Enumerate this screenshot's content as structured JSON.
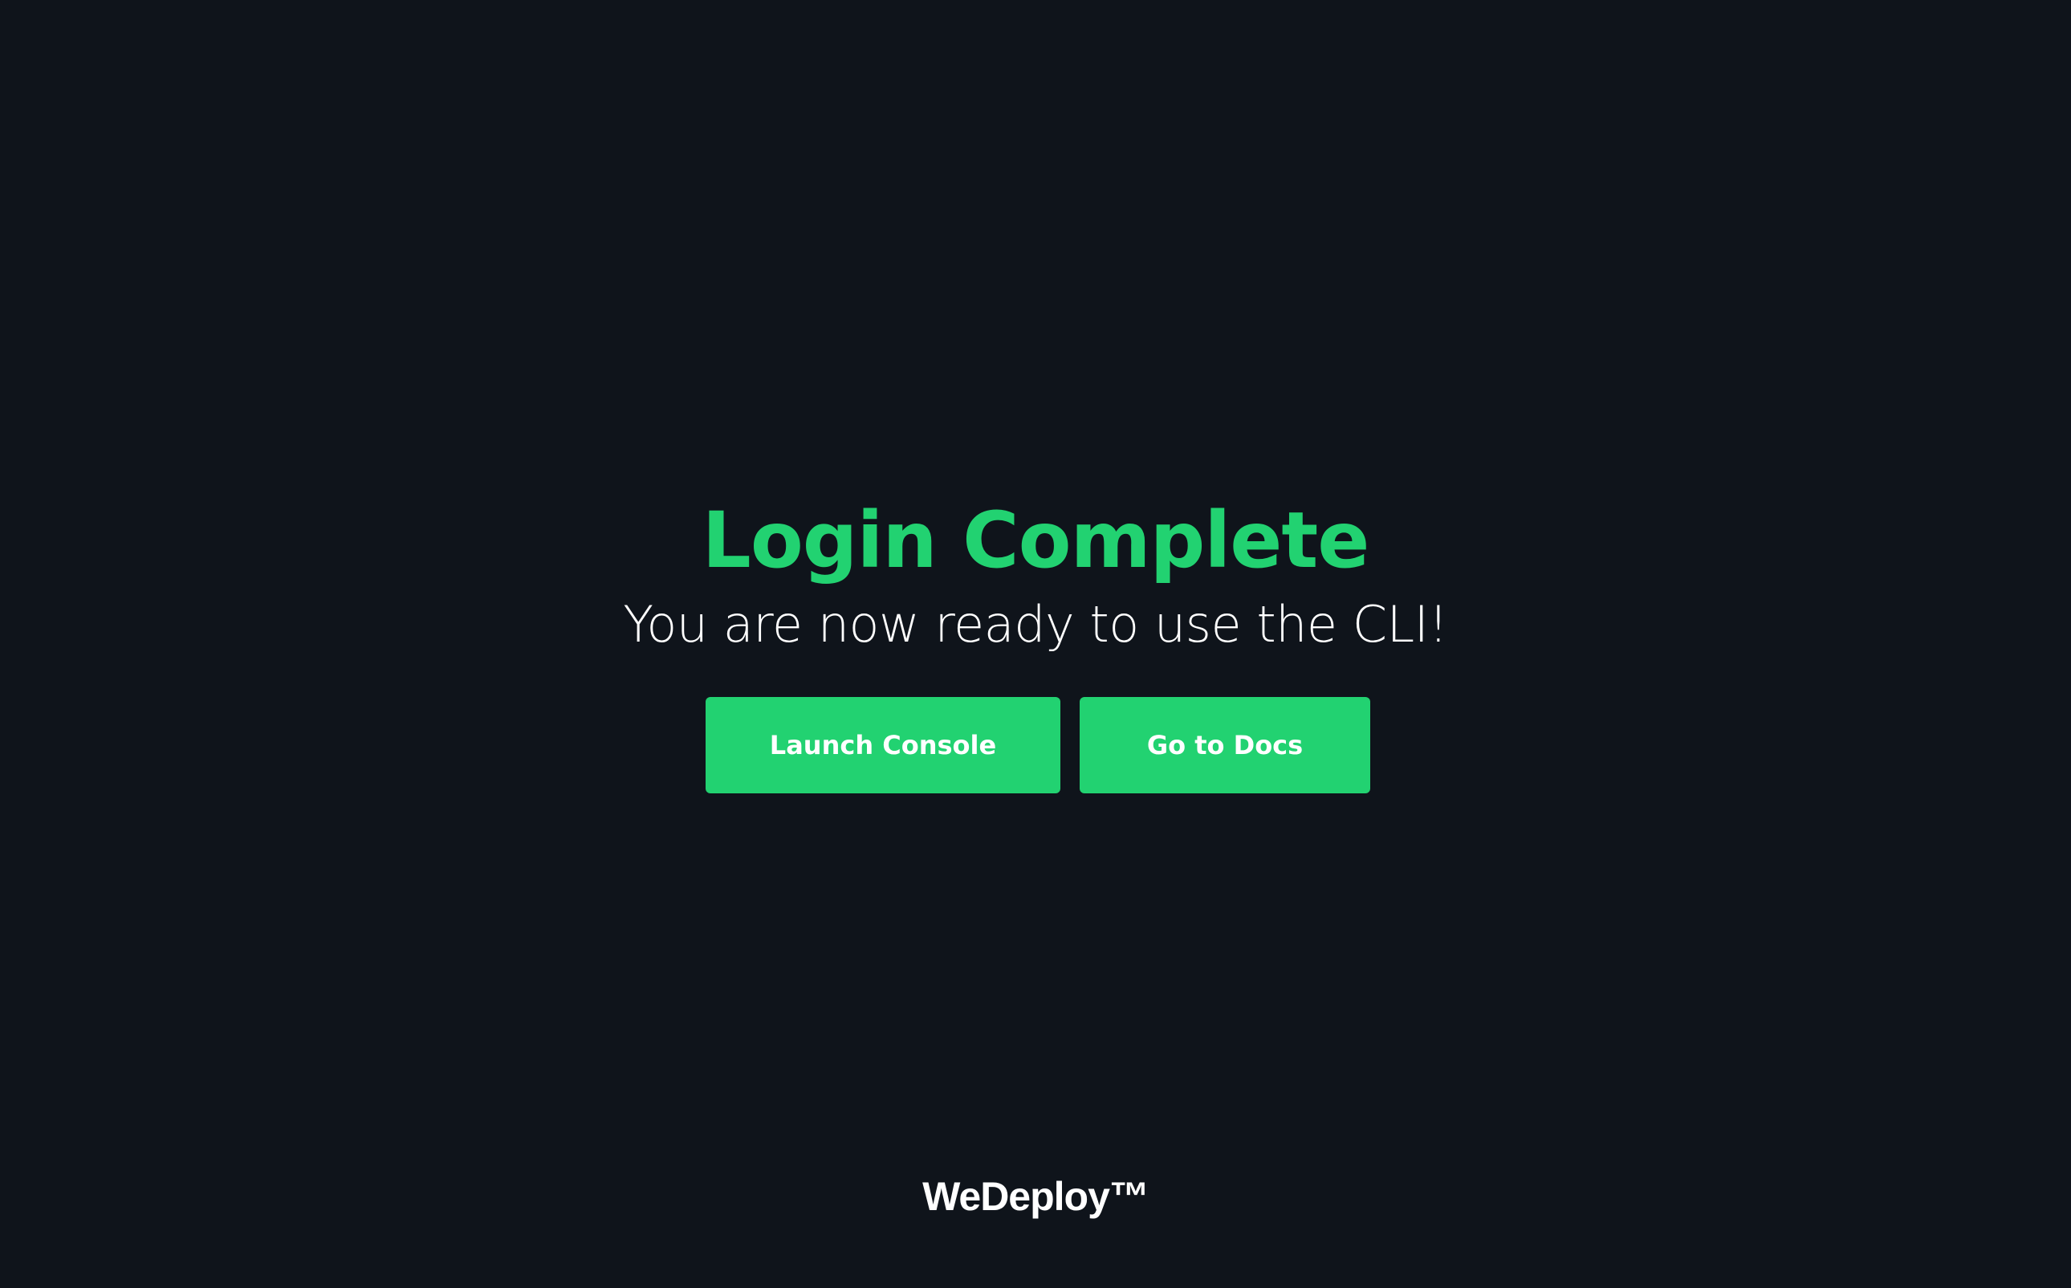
{
  "colors": {
    "background": "#0f141b",
    "accent": "#22d271",
    "text": "#ffffff"
  },
  "main": {
    "title": "Login Complete",
    "subtitle": "You are now ready to use the CLI!",
    "buttons": {
      "console_label": "Launch Console",
      "docs_label": "Go to Docs"
    }
  },
  "footer": {
    "brand": "WeDeploy™"
  }
}
